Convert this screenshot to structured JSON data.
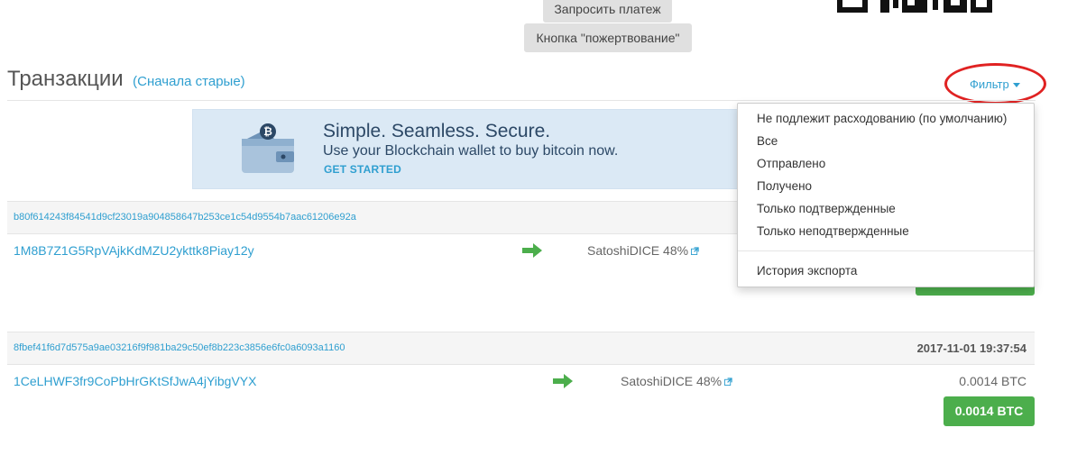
{
  "top_buttons": {
    "request_payment": "Запросить платеж",
    "donation_button": "Кнопка \"пожертвование\""
  },
  "transactions": {
    "title": "Транзакции",
    "sort_label": "(Сначала старые)",
    "filter_label": "Фильтр"
  },
  "banner": {
    "title": "Simple. Seamless. Secure.",
    "subtitle": "Use your Blockchain wallet to buy bitcoin now.",
    "cta": "GET STARTED"
  },
  "tx_list": [
    {
      "hash": "b80f614243f84541d9cf23019a904858647b253ce1c54d9554b7aac61206e92a",
      "date": "",
      "from": "1M8B7Z1G5RpVAjkKdMZU2ykttk8Piay12y",
      "to": "SatoshiDICE 48%",
      "amount": "",
      "amount_button": ""
    },
    {
      "hash": "8fbef41f6d7d575a9ae03216f9f981ba29c50ef8b223c3856e6fc0a6093a1160",
      "date": "2017-11-01 19:37:54",
      "from": "1CeLHWF3fr9CoPbHrGKtSfJwA4jYibgVYX",
      "to": "SatoshiDICE 48%",
      "amount": "0.0014 BTC",
      "amount_button": "0.0014 BTC"
    }
  ],
  "filter_menu": {
    "items": [
      "Не подлежит расходованию (по умолчанию)",
      "Все",
      "Отправлено",
      "Получено",
      "Только подтвержденные",
      "Только неподтвержденные"
    ],
    "export": "История экспорта"
  },
  "colors": {
    "link": "#2f9fd0",
    "success": "#4cae4c",
    "highlight_circle": "#e02222",
    "banner_bg": "#dbe9f5"
  }
}
